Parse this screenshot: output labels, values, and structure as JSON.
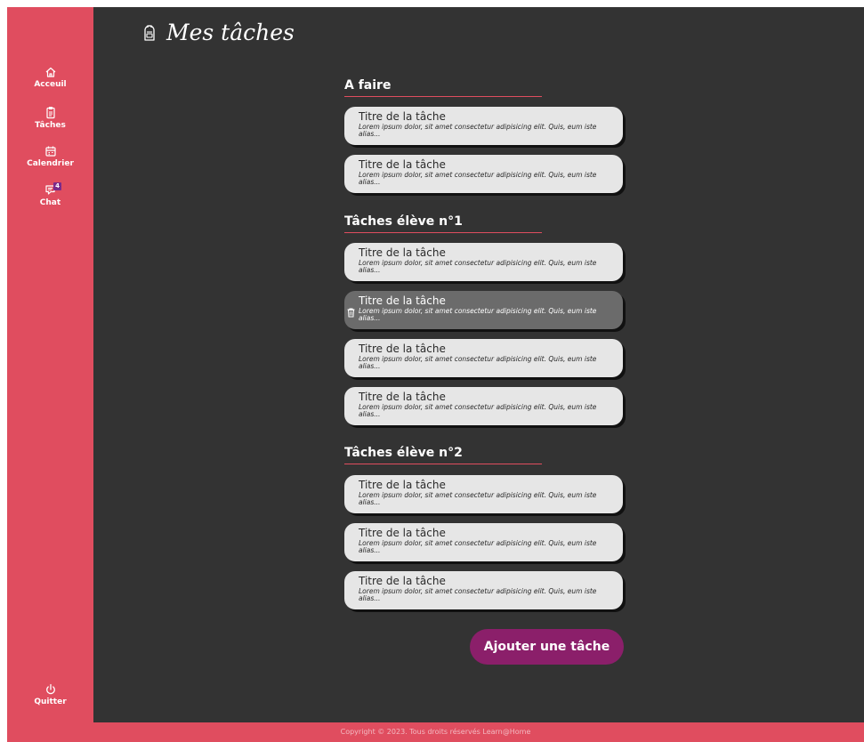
{
  "sidebar": {
    "items": [
      {
        "label": "Acceuil",
        "icon": "home-icon"
      },
      {
        "label": "Tâches",
        "icon": "clipboard-icon"
      },
      {
        "label": "Calendrier",
        "icon": "calendar-icon"
      },
      {
        "label": "Chat",
        "icon": "chat-icon",
        "badge": "4"
      }
    ],
    "quit_label": "Quitter"
  },
  "header": {
    "title": "Mes tâches",
    "icon": "backpack-icon"
  },
  "sections": [
    {
      "title": "A faire",
      "tasks": [
        {
          "title": "Titre de la tâche",
          "desc": "Lorem ipsum dolor, sit amet consectetur adipisicing elit. Quis, eum iste alias..."
        },
        {
          "title": "Titre de la tâche",
          "desc": "Lorem ipsum dolor, sit amet consectetur adipisicing elit. Quis, eum iste alias..."
        }
      ]
    },
    {
      "title": "Tâches élève n°1",
      "tasks": [
        {
          "title": "Titre de la tâche",
          "desc": "Lorem ipsum dolor, sit amet consectetur adipisicing elit. Quis, eum iste alias..."
        },
        {
          "title": "Titre de la tâche",
          "desc": "Lorem ipsum dolor, sit amet consectetur adipisicing elit. Quis, eum iste alias..."
        },
        {
          "title": "Titre de la tâche",
          "desc": "Lorem ipsum dolor, sit amet consectetur adipisicing elit. Quis, eum iste alias..."
        },
        {
          "title": "Titre de la tâche",
          "desc": "Lorem ipsum dolor, sit amet consectetur adipisicing elit. Quis, eum iste alias..."
        }
      ]
    },
    {
      "title": "Tâches élève n°2",
      "tasks": [
        {
          "title": "Titre de la tâche",
          "desc": "Lorem ipsum dolor, sit amet consectetur adipisicing elit. Quis, eum iste alias..."
        },
        {
          "title": "Titre de la tâche",
          "desc": "Lorem ipsum dolor, sit amet consectetur adipisicing elit. Quis, eum iste alias..."
        },
        {
          "title": "Titre de la tâche",
          "desc": "Lorem ipsum dolor, sit amet consectetur adipisicing elit. Quis, eum iste alias..."
        }
      ]
    }
  ],
  "add_button_label": "Ajouter une tâche",
  "footer_text": "Copyright © 2023. Tous droits réservés Learn@Home",
  "colors": {
    "sidebar": "#e04d5f",
    "background": "#333333",
    "accent_button": "#8b1f6a",
    "card": "#e6e6e6",
    "card_hover": "#6b6b6b"
  }
}
